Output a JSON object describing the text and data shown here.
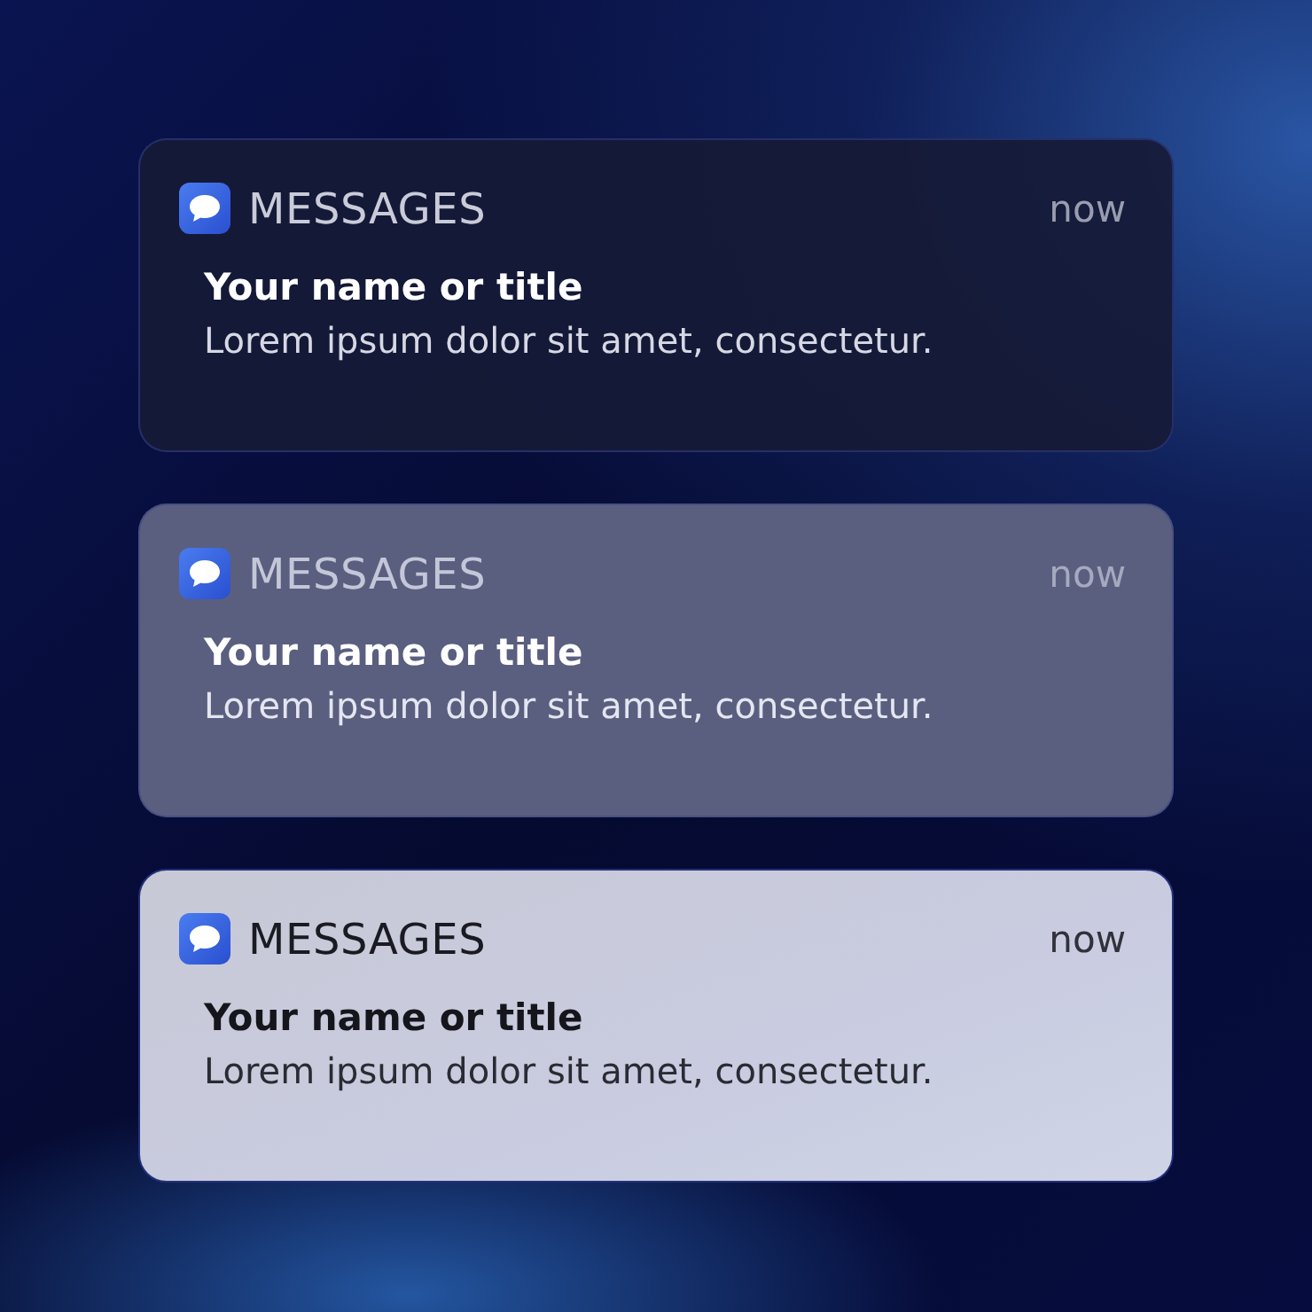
{
  "notifications": [
    {
      "kind": "dark",
      "app": "MESSAGES",
      "time": "now",
      "title": "Your name or title",
      "body": "Lorem ipsum dolor sit amet, consectetur."
    },
    {
      "kind": "dim",
      "app": "MESSAGES",
      "time": "now",
      "title": "Your name or title",
      "body": "Lorem ipsum dolor sit amet, consectetur."
    },
    {
      "kind": "light",
      "app": "MESSAGES",
      "time": "now",
      "title": "Your name or title",
      "body": "Lorem ipsum dolor sit amet, consectetur."
    }
  ]
}
